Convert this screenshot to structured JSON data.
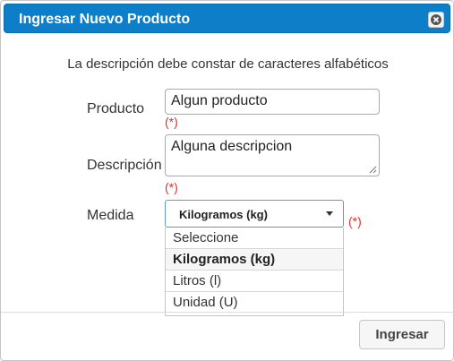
{
  "dialog": {
    "title": "Ingresar Nuevo Producto",
    "close_icon": "close-icon",
    "message": "La descripción debe constar de caracteres alfabéticos"
  },
  "form": {
    "producto": {
      "label": "Producto",
      "value": "Algun producto",
      "required_marker": "(*)"
    },
    "descripcion": {
      "label": "Descripción",
      "value": "Alguna descripcion",
      "required_marker": "(*)"
    },
    "medida": {
      "label": "Medida",
      "selected": "Kilogramos (kg)",
      "required_marker": "(*)",
      "options": [
        "Seleccione",
        "Kilogramos (kg)",
        "Litros (l)",
        "Unidad (U)"
      ]
    }
  },
  "footer": {
    "submit_label": "Ingresar"
  },
  "colors": {
    "titlebar": "#0f7ec8",
    "required": "#e03030"
  }
}
